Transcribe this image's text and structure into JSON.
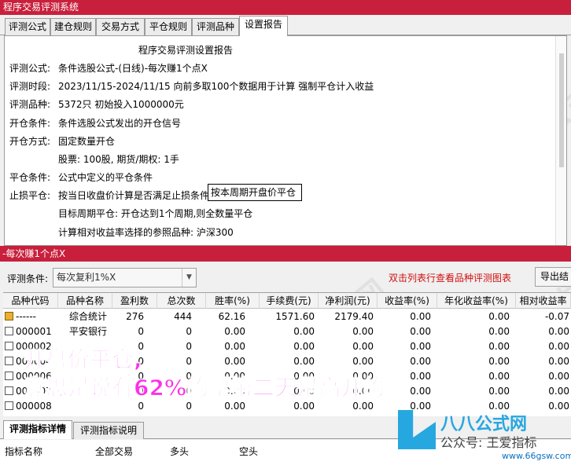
{
  "window": {
    "title": "程序交易评测系统"
  },
  "tabs": [
    "评测公式",
    "建仓规则",
    "交易方式",
    "平仓规则",
    "评测品种",
    "设置报告"
  ],
  "report": {
    "heading": "程序交易评测设置报告",
    "lines": [
      {
        "label": "评测公式:",
        "value": "条件选股公式-(日线)-每次赚1个点X"
      },
      {
        "label": "评测时段:",
        "value": "2023/11/15-2024/11/15 向前多取100个数据用于计算 强制平仓计入收益"
      },
      {
        "label": "评测品种:",
        "value": "5372只 初始投入1000000元"
      },
      {
        "label": "开仓条件:",
        "value": "条件选股公式发出的开仓信号"
      },
      {
        "label": "开仓方式:",
        "value": "固定数量开仓"
      },
      {
        "label": "",
        "value": "股票: 100股, 期货/期权: 1手"
      },
      {
        "label": "平仓条件:",
        "value": "公式中定义的平仓条件"
      },
      {
        "label": "止损平仓:",
        "value": "按当日收盘价计算是否满足止损条件,"
      },
      {
        "label": "",
        "value": "目标周期平仓: 开仓达到1个周期,则全数量平仓"
      },
      {
        "label": "",
        "value": "计算相对收益率选择的参照品种: 沪深300"
      }
    ],
    "highlight_box": "按本周期开盘价平仓"
  },
  "result_panel": {
    "title": "-每次赚1个点X",
    "condition_label": "评测条件:",
    "condition_value": "每次复利1%X",
    "hint": "双击列表行查看品种评测图表",
    "export_button": "导出结"
  },
  "table": {
    "columns": [
      "品种代码",
      "品种名称",
      "盈利数",
      "总次数",
      "胜率(%)",
      "手续费(元)",
      "净利润(元)",
      "收益率(%)",
      "年化收益率(%)",
      "相对收益率"
    ],
    "rows": [
      [
        "------",
        "综合统计",
        "276",
        "444",
        "62.16",
        "1571.60",
        "2179.40",
        "0.00",
        "0.00",
        "-0.07"
      ],
      [
        "000001",
        "平安银行",
        "0",
        "0",
        "0.00",
        "0.00",
        "0.00",
        "0.00",
        "0.00",
        "0.00"
      ],
      [
        "000002",
        "",
        "0",
        "0",
        "0.00",
        "0.00",
        "0.00",
        "0.00",
        "0.00",
        "0.00"
      ],
      [
        "000004",
        "",
        "0",
        "0",
        "0.00",
        "0.00",
        "0.00",
        "0.00",
        "0.00",
        "0.00"
      ],
      [
        "000006",
        "",
        "0",
        "0",
        "0.00",
        "0.00",
        "0.00",
        "0.00",
        "0.00",
        "0.00"
      ],
      [
        "000007",
        "",
        "0",
        "0",
        "0.00",
        "0.00",
        "0.00",
        "0.00",
        "0.00",
        "0.00"
      ],
      [
        "000008",
        "",
        "0",
        "0",
        "0.00",
        "0.00",
        "0.00",
        "0.00",
        "0.00",
        "0.00"
      ]
    ]
  },
  "overlay": {
    "line1": "开盘价平仓,",
    "line2": "意思是说有62%的票第二天是高开的。"
  },
  "bottom_tabs": [
    "评测指标详情",
    "评测指标说明"
  ],
  "bottom_columns": [
    "指标名称",
    "全部交易",
    "多头",
    "空头"
  ],
  "watermark": {
    "text": "八八公式网",
    "site_cn": "八八公式网",
    "site_sub": "公众号: 王爱指标",
    "url": "www.66gsw.com"
  },
  "colors": {
    "title_bar": "#c8203c",
    "overlay_text": "#ff2eea",
    "hint": "#d01010",
    "logo": "#27a7e0"
  }
}
